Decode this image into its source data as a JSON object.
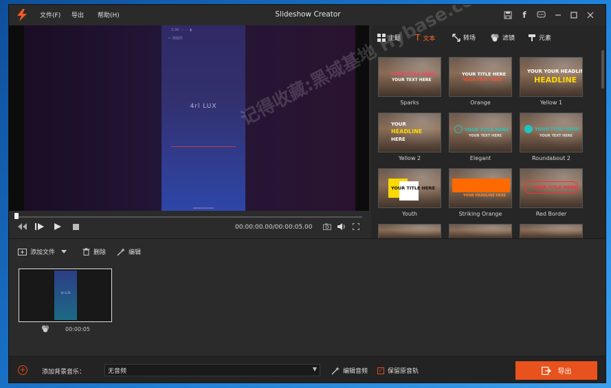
{
  "window": {
    "title": "Slideshow Creator",
    "menu": [
      "文件(F)",
      "导出",
      "帮助(H)"
    ],
    "title_buttons": [
      "save-icon",
      "facebook-icon",
      "feedback-icon",
      "minimize-icon",
      "maximize-icon",
      "close-icon"
    ]
  },
  "preview": {
    "phone_status": "2:30  ····  ···  ▮",
    "phone_header": "←  消消乐",
    "phone_center_text": "4rl LUX",
    "progress": 0.0,
    "timecode": "00:00:00.00/00:00:05.00"
  },
  "panel": {
    "tabs": [
      {
        "label": "主题",
        "icon": "theme-grid-icon"
      },
      {
        "label": "文本",
        "icon": "text-icon",
        "active": true
      },
      {
        "label": "转场",
        "icon": "transition-icon"
      },
      {
        "label": "滤镜",
        "icon": "filter-icon"
      },
      {
        "label": "元素",
        "icon": "element-icon"
      }
    ],
    "templates": [
      {
        "name": "Sparks",
        "line1": "YOUR TITLE HERE",
        "line2": "YOUR TEXT HERE"
      },
      {
        "name": "Orange",
        "line1": "YOUR TITLE HERE",
        "line2": "YOUR TEXT HERE"
      },
      {
        "name": "Yellow 1",
        "line1": "YOUR YOUR HEADLINE",
        "line2": "HEADLINE"
      },
      {
        "name": "Yellow 2",
        "line1": "YOUR",
        "line2": "HEADLINE",
        "line3": "HERE"
      },
      {
        "name": "Elegant",
        "line1": "YOUR TITLE HERE",
        "line2": "YOUR TEXT HERE"
      },
      {
        "name": "Roundabout 2",
        "line1": "YOUR TITLE HERE",
        "line2": "YOUR TEXT HERE"
      },
      {
        "name": "Youth",
        "line1": "YOUR TITLE HERE",
        "line2": ""
      },
      {
        "name": "Striking Orange",
        "line1": "",
        "line2": "YOUR HEADLINE HERE"
      },
      {
        "name": "Red Border",
        "line1": "YOUR TITLE HERE",
        "line2": ""
      }
    ]
  },
  "toolbar": {
    "add_file": "添加文件",
    "delete": "删除",
    "edit": "编辑"
  },
  "clip": {
    "duration": "00:00:05",
    "inner_text": "4rl LUX"
  },
  "bottom": {
    "bg_music_label": "添加背景音乐：",
    "music_value": "无音频",
    "edit_audio": "编辑音频",
    "keep_audio": "保留原音轨",
    "export": "导出"
  },
  "watermark": "记得收藏:黑域基地 Hybase.com",
  "colors": {
    "accent": "#e8531d",
    "active_tab": "#ff6a2b"
  }
}
